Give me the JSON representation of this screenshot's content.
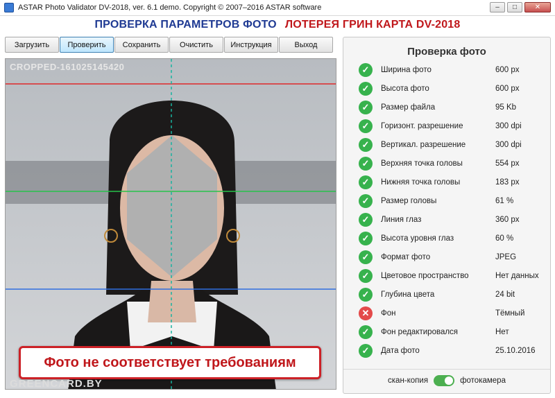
{
  "window": {
    "title": "ASTAR Photo Validator DV-2018, ver. 6.1 demo.  Copyright © 2007–2016 ASTAR software",
    "minimize": "–",
    "maximize": "□",
    "close": "✕"
  },
  "header": {
    "left": "ПРОВЕРКА ПАРАМЕТРОВ ФОТО",
    "right": "ЛОТЕРЕЯ ГРИН КАРТА DV-2018",
    "left_color": "#1f3a93",
    "right_color": "#c0171b"
  },
  "toolbar": {
    "buttons": [
      "Загрузить",
      "Проверить",
      "Сохранить",
      "Очистить",
      "Инструкция",
      "Выход"
    ],
    "active": "Проверить"
  },
  "photo": {
    "overlay_label": "CROPPED-161025145420",
    "verdict": "Фото не соответствует требованиям",
    "watermark": "GREENCARD.BY"
  },
  "panel": {
    "title": "Проверка фото",
    "checks": [
      {
        "label": "Ширина фото",
        "value": "600 px",
        "status": "ok"
      },
      {
        "label": "Высота фото",
        "value": "600 px",
        "status": "ok"
      },
      {
        "label": "Размер файла",
        "value": "95 Kb",
        "status": "ok"
      },
      {
        "label": "Горизонт. разрешение",
        "value": "300 dpi",
        "status": "ok"
      },
      {
        "label": "Вертикал. разрешение",
        "value": "300 dpi",
        "status": "ok"
      },
      {
        "label": "Верхняя точка головы",
        "value": "554 px",
        "status": "ok"
      },
      {
        "label": "Нижняя точка головы",
        "value": "183 px",
        "status": "ok"
      },
      {
        "label": "Размер головы",
        "value": "61 %",
        "status": "ok"
      },
      {
        "label": "Линия глаз",
        "value": "360 px",
        "status": "ok"
      },
      {
        "label": "Высота уровня глаз",
        "value": "60 %",
        "status": "ok"
      },
      {
        "label": "Формат фото",
        "value": "JPEG",
        "status": "ok"
      },
      {
        "label": "Цветовое пространство",
        "value": "Нет данных",
        "status": "ok"
      },
      {
        "label": "Глубина цвета",
        "value": "24 bit",
        "status": "ok"
      },
      {
        "label": "Фон",
        "value": "Тёмный",
        "status": "fail"
      },
      {
        "label": "Фон редактировался",
        "value": "Нет",
        "status": "ok"
      },
      {
        "label": "Дата фото",
        "value": "25.10.2016",
        "status": "ok"
      }
    ],
    "toggle": {
      "left_label": "скан-копия",
      "right_label": "фотокамера",
      "on": true
    }
  },
  "colors": {
    "ok": "#37b24d",
    "fail": "#e34a4a",
    "accent_blue": "#3c7fb1"
  }
}
